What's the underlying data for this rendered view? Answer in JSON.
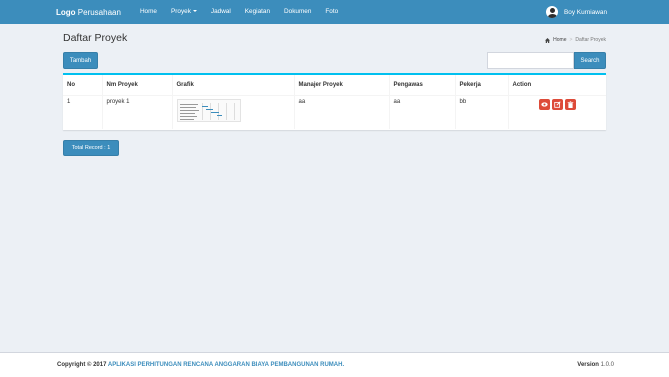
{
  "navbar": {
    "brand_bold": "Logo",
    "brand_rest": "Perusahaan",
    "items": [
      {
        "label": "Home"
      },
      {
        "label": "Proyek"
      },
      {
        "label": "Jadwal"
      },
      {
        "label": "Kegiatan"
      },
      {
        "label": "Dokumen"
      },
      {
        "label": "Foto"
      }
    ],
    "user_name": "Boy Kurniawan"
  },
  "header": {
    "title": "Daftar Proyek",
    "breadcrumb": {
      "home": "Home",
      "current": "Daftar Proyek"
    }
  },
  "toolbar": {
    "add_label": "Tambah",
    "search_value": "",
    "search_label": "Search"
  },
  "table": {
    "columns": [
      "No",
      "Nm Proyek",
      "Grafik",
      "Manajer Proyek",
      "Pengawas",
      "Pekerja",
      "Action"
    ],
    "rows": [
      {
        "no": "1",
        "nm_proyek": "proyek 1",
        "manajer": "aa",
        "pengawas": "aa",
        "pekerja": "bb"
      }
    ]
  },
  "total_record": "Total Record : 1",
  "footer": {
    "copyright": "Copyright © 2017",
    "app_name": "APLIKASI PERHITUNGAN RENCANA ANGGARAN BIAYA PEMBANGUNAN RUMAH.",
    "version_label": "Version",
    "version_value": "1.0.0"
  },
  "colors": {
    "primary": "#3c8dbc",
    "danger": "#dd4b39",
    "box_accent": "#00c0ef",
    "background": "#ecf0f5"
  },
  "icons": [
    "user-avatar",
    "home-icon",
    "eye-icon",
    "edit-icon",
    "trash-icon"
  ]
}
